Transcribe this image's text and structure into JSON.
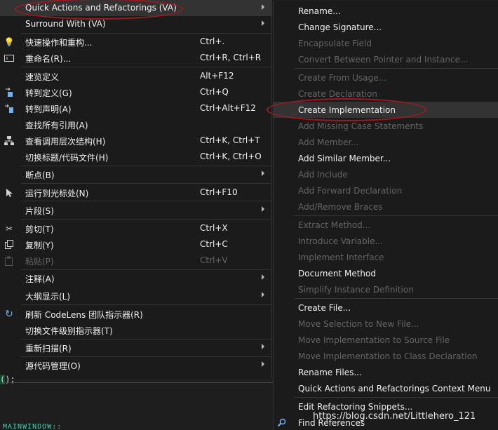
{
  "main_menu": {
    "items": [
      {
        "label": "Quick Actions and Refactorings (VA)",
        "top": 0
      },
      {
        "label": "Surround With (VA)"
      },
      {
        "label": "快速操作和重构...",
        "shortcut": "Ctrl+."
      },
      {
        "label": "重命名(R)...",
        "shortcut": "Ctrl+R, Ctrl+R"
      },
      {
        "label": "速览定义",
        "shortcut": "Alt+F12"
      },
      {
        "label": "转到定义(G)",
        "shortcut": "Ctrl+Q"
      },
      {
        "label": "转到声明(A)",
        "shortcut": "Ctrl+Alt+F12"
      },
      {
        "label": "查找所有引用(A)"
      },
      {
        "label": "查看调用层次结构(H)",
        "shortcut": "Ctrl+K, Ctrl+T"
      },
      {
        "label": "切换标题/代码文件(H)",
        "shortcut": "Ctrl+K, Ctrl+O"
      },
      {
        "label": "断点(B)"
      },
      {
        "label": "运行到光标处(N)",
        "shortcut": "Ctrl+F10"
      },
      {
        "label": "片段(S)"
      },
      {
        "label": "剪切(T)",
        "shortcut": "Ctrl+X"
      },
      {
        "label": "复制(Y)",
        "shortcut": "Ctrl+C"
      },
      {
        "label": "粘贴(P)",
        "shortcut": "Ctrl+V"
      },
      {
        "label": "注释(A)"
      },
      {
        "label": "大纲显示(L)"
      },
      {
        "label": "刷新 CodeLens 团队指示器(R)"
      },
      {
        "label": "切换文件级别指示器(T)"
      },
      {
        "label": "重新扫描(R)"
      },
      {
        "label": "源代码管理(O)"
      }
    ]
  },
  "sub_menu": {
    "items": [
      {
        "label": "Rename..."
      },
      {
        "label": "Change Signature..."
      },
      {
        "label": "Encapsulate Field"
      },
      {
        "label": "Convert Between Pointer and Instance..."
      },
      {
        "label": "Create From Usage..."
      },
      {
        "label": "Create Declaration"
      },
      {
        "label": "Create Implementation"
      },
      {
        "label": "Add Missing Case Statements"
      },
      {
        "label": "Add Member..."
      },
      {
        "label": "Add Similar Member..."
      },
      {
        "label": "Add Include"
      },
      {
        "label": "Add Forward Declaration"
      },
      {
        "label": "Add/Remove Braces"
      },
      {
        "label": "Extract Method..."
      },
      {
        "label": "Introduce Variable..."
      },
      {
        "label": "Implement Interface"
      },
      {
        "label": "Document Method"
      },
      {
        "label": "Simplify Instance Definition"
      },
      {
        "label": "Create File..."
      },
      {
        "label": "Move Selection to New File..."
      },
      {
        "label": "Move Implementation to Source File"
      },
      {
        "label": "Move Implementation to Class Declaration"
      },
      {
        "label": "Rename Files..."
      },
      {
        "label": "Quick Actions and Refactorings Context Menu"
      },
      {
        "label": "Edit Refactoring Snippets..."
      },
      {
        "label": "Find References"
      }
    ]
  },
  "editor": {
    "code_fragment_paren": "(",
    "code_fragment_rest": ");",
    "code_bottom": "MAINWINDOW::"
  },
  "watermark": "https://blog.csdn.net/Littlehero_121",
  "colors": {
    "menu_bg": "#1b1b1c",
    "highlight": "#333334",
    "disabled_text": "#656565",
    "annotation_ring": "#9e1a20"
  }
}
